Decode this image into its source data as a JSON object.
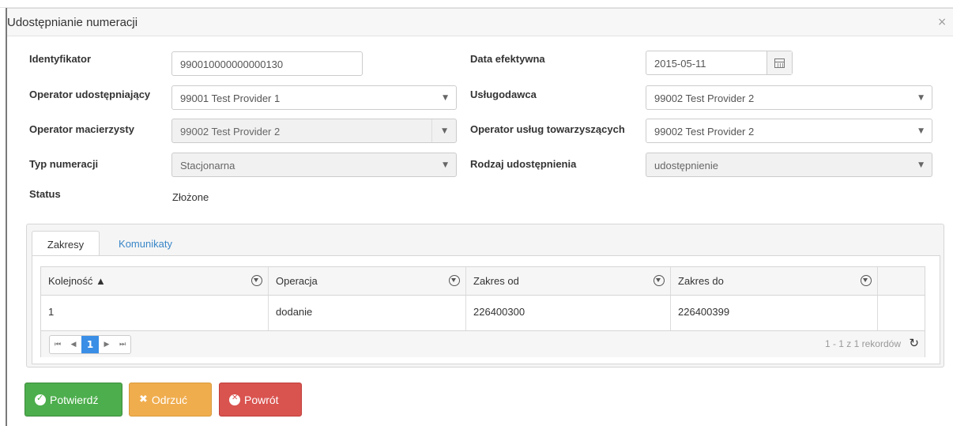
{
  "dialog": {
    "title": "Udostępnianie numeracji",
    "close_glyph": "×"
  },
  "form": {
    "identyfikator": {
      "label": "Identyfikator",
      "value": "990010000000000130"
    },
    "data_efektywna": {
      "label": "Data efektywna",
      "value": "2015-05-11",
      "icon": "calendar-icon"
    },
    "operator_udostepniajacy": {
      "label": "Operator udostępniający",
      "value": "99001 Test Provider 1"
    },
    "uslugodawca": {
      "label": "Usługodawca",
      "value": "99002 Test Provider 2"
    },
    "operator_macierzysty": {
      "label": "Operator macierzysty",
      "value": "99002 Test Provider 2"
    },
    "operator_uslug": {
      "label": "Operator usług towarzyszących",
      "value": "99002 Test Provider 2"
    },
    "typ_numeracji": {
      "label": "Typ numeracji",
      "value": "Stacjonarna"
    },
    "rodzaj_udostepnienia": {
      "label": "Rodzaj udostępnienia",
      "value": "udostępnienie"
    },
    "status": {
      "label": "Status",
      "value": "Złożone"
    }
  },
  "tabs": [
    {
      "label": "Zakresy",
      "active": true
    },
    {
      "label": "Komunikaty",
      "active": false
    }
  ],
  "grid": {
    "columns": [
      "Kolejność ▲",
      "Operacja",
      "Zakres od",
      "Zakres do"
    ],
    "rows": [
      [
        "1",
        "dodanie",
        "226400300",
        "226400399"
      ]
    ],
    "pager": {
      "first": "⏮",
      "prev": "◀",
      "current_page": "1",
      "next": "▶",
      "last": "⏭",
      "info": "1 - 1 z 1 rekordów",
      "refresh_icon": "↻"
    }
  },
  "buttons": {
    "confirm": "Potwierdź",
    "reject": "Odrzuć",
    "back": "Powrót"
  },
  "colors": {
    "confirm": "#4cae4c",
    "reject": "#f0ad4e",
    "back": "#d9534f",
    "link": "#3a86c8",
    "pager_active": "#3a8ee6"
  }
}
